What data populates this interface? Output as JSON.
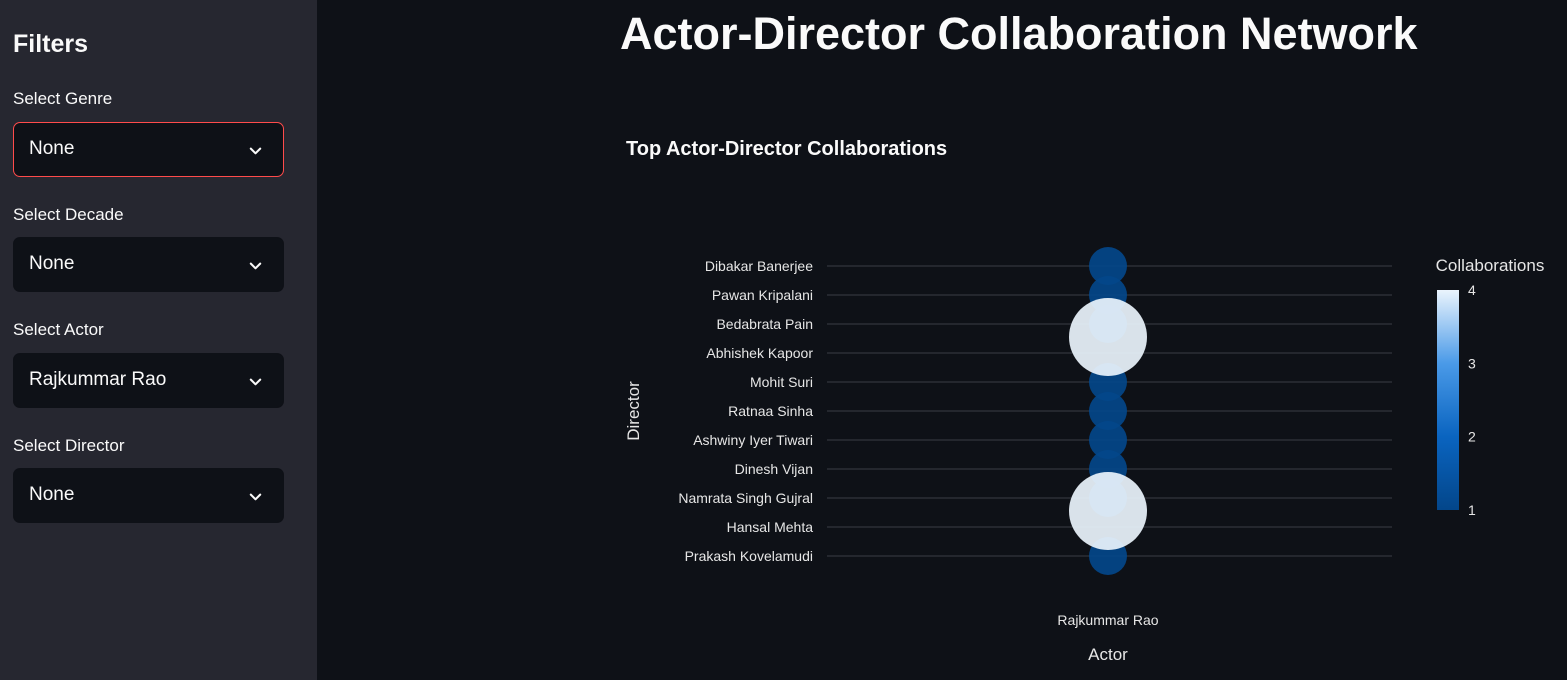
{
  "sidebar": {
    "title": "Filters",
    "filters": [
      {
        "label": "Select Genre",
        "value": "None"
      },
      {
        "label": "Select Decade",
        "value": "None"
      },
      {
        "label": "Select Actor",
        "value": "Rajkummar Rao"
      },
      {
        "label": "Select Director",
        "value": "None"
      }
    ]
  },
  "main": {
    "title": "Actor-Director Collaboration Network"
  },
  "chart_data": {
    "type": "scatter",
    "title": "Top Actor-Director Collaborations",
    "xlabel": "Actor",
    "ylabel": "Director",
    "x_categories": [
      "Rajkummar Rao"
    ],
    "y_categories": [
      "Dibakar Banerjee",
      "Pawan Kripalani",
      "Bedabrata Pain",
      "Abhishek Kapoor",
      "Mohit Suri",
      "Ratnaa Sinha",
      "Ashwiny Iyer Tiwari",
      "Dinesh Vijan",
      "Namrata Singh Gujral",
      "Hansal Mehta",
      "Prakash Kovelamudi"
    ],
    "points": [
      {
        "x": "Rajkummar Rao",
        "y": "Dibakar Banerjee",
        "collaborations": 1
      },
      {
        "x": "Rajkummar Rao",
        "y": "Pawan Kripalani",
        "collaborations": 1
      },
      {
        "x": "Rajkummar Rao",
        "y": "Bedabrata Pain",
        "collaborations": 1
      },
      {
        "x": "Rajkummar Rao",
        "y": "Abhishek Kapoor",
        "collaborations": 4
      },
      {
        "x": "Rajkummar Rao",
        "y": "Mohit Suri",
        "collaborations": 1
      },
      {
        "x": "Rajkummar Rao",
        "y": "Ratnaa Sinha",
        "collaborations": 1
      },
      {
        "x": "Rajkummar Rao",
        "y": "Ashwiny Iyer Tiwari",
        "collaborations": 1
      },
      {
        "x": "Rajkummar Rao",
        "y": "Dinesh Vijan",
        "collaborations": 1
      },
      {
        "x": "Rajkummar Rao",
        "y": "Namrata Singh Gujral",
        "collaborations": 1
      },
      {
        "x": "Rajkummar Rao",
        "y": "Hansal Mehta",
        "collaborations": 4
      },
      {
        "x": "Rajkummar Rao",
        "y": "Prakash Kovelamudi",
        "collaborations": 1
      }
    ],
    "colorbar": {
      "title": "Collaborations",
      "ticks": [
        1,
        2,
        3,
        4
      ],
      "range": [
        1,
        4
      ],
      "colors": [
        "#03468a",
        "#0a64c0",
        "#4a9ae8",
        "#eaf4fd"
      ]
    },
    "grid": true,
    "legend_position": "right"
  }
}
